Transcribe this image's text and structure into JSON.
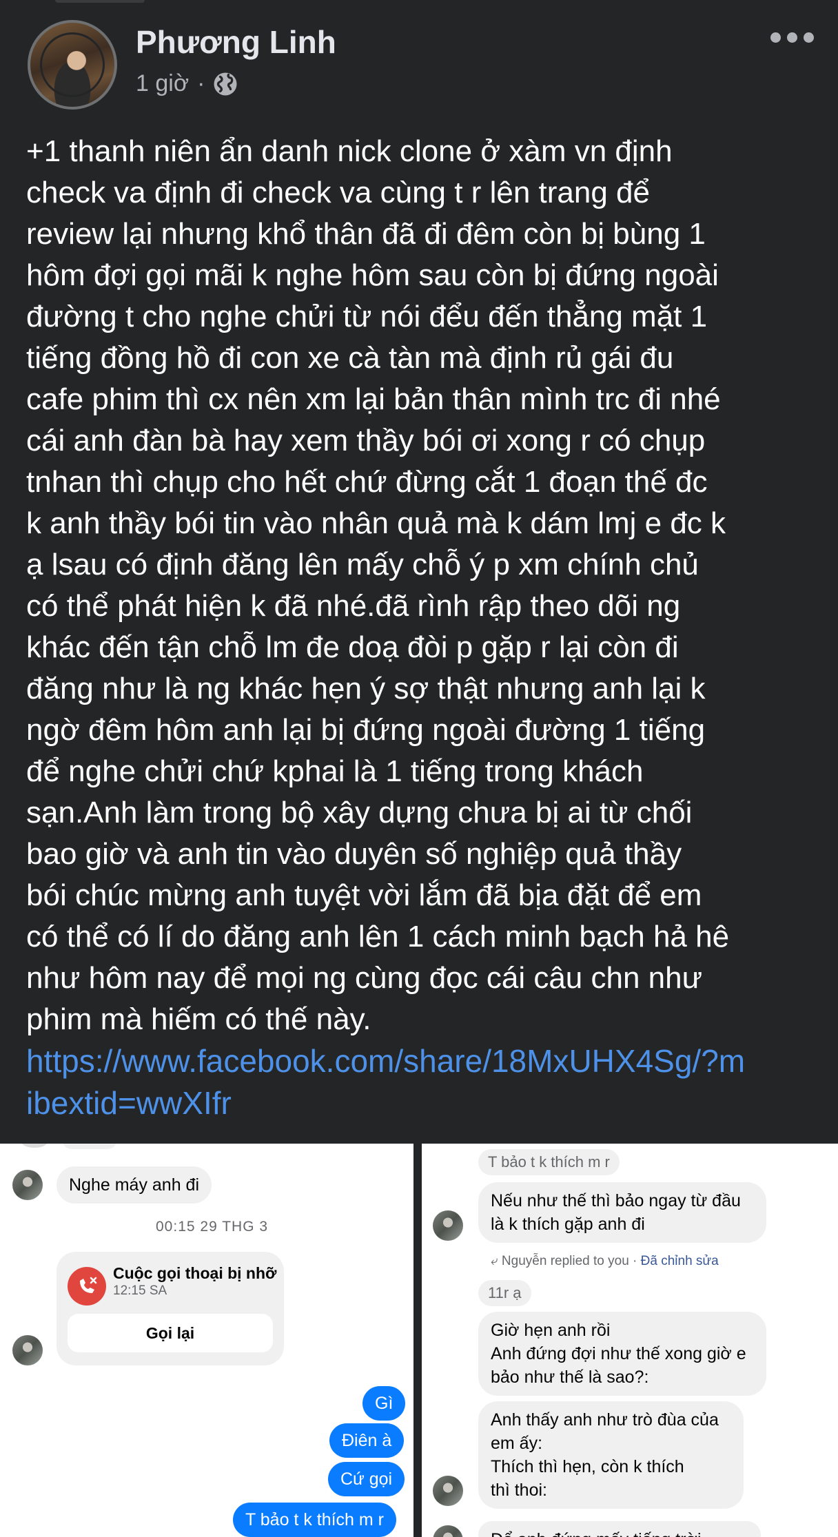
{
  "post": {
    "author": "Phương Linh",
    "time": "1 giờ",
    "separator": "·",
    "privacy_icon": "globe-icon",
    "more_icon": "more-horizontal-icon",
    "text_lines": [
      "+1 thanh niên ẩn danh nick clone ở xàm vn định",
      "check va định đi check va cùng t r lên trang để",
      "review lại nhưng khổ thân đã đi đêm còn bị bùng 1",
      "hôm đợi gọi mãi k nghe hôm sau còn bị đứng ngoài",
      "đường t cho nghe chửi từ nói đểu đến thẳng mặt 1",
      "tiếng đồng hồ đi con xe cà tàn mà định rủ gái đu",
      "cafe phim thì cx nên xm lại bản thân mình trc đi nhé",
      "cái anh đàn bà hay xem thầy bói ơi xong r có chụp",
      "tnhan thì chụp cho hết chứ đừng cắt 1 đoạn thế đc",
      "k anh thầy bói tin vào nhân quả mà k dám lmj e đc k",
      "ạ lsau có định đăng lên mấy chỗ ý p xm chính chủ",
      "có thể phát hiện k đã nhé.đã rình rập theo dõi ng",
      "khác đến tận chỗ lm đe doạ đòi p gặp r lại còn đi",
      "đăng như là ng khác hẹn ý sợ thật nhưng anh lại k",
      "ngờ đêm hôm anh lại bị đứng ngoài đường 1 tiếng",
      "để nghe chửi chứ kphai là 1 tiếng trong khách",
      "sạn.Anh làm trong bộ xây dựng chưa bị ai từ chối",
      "bao giờ và anh tin vào duyên số nghiệp quả thầy",
      "bói chúc mừng anh tuyệt vời lắm đã bịa đặt để em",
      "có thể có lí do đăng anh lên 1 cách minh bạch hả hê",
      "như hôm nay để mọi ng cùng đọc cái câu chn như",
      "phim mà hiếm có thế này."
    ],
    "link_lines": [
      "https://www.facebook.com/share/18MxUHX4Sg/?m",
      "ibextid=wwXIfr"
    ]
  },
  "left_chat": {
    "incoming_message": "Nghe máy anh đi",
    "timestamp": "00:15 29 THG 3",
    "missed_call": {
      "title": "Cuộc gọi thoại bị nhỡ",
      "time": "12:15 SA",
      "button": "Gọi lại"
    },
    "outgoing": [
      "Gì",
      "Điên à",
      "Cứ gọi",
      "T bảo t k thích m r"
    ]
  },
  "right_chat": {
    "quoted_top": "T bảo t k thích m r",
    "message1": [
      "Nếu như thế thì bảo ngay từ đầu",
      "là k thích gặp anh đi"
    ],
    "reply_header": "Nguyễn replied to you",
    "reply_edited": "Đã chỉnh sửa",
    "reply_quote": "11r ạ",
    "message2": [
      "Giờ hẹn anh rồi",
      "Anh đứng đợi như thế xong giờ e",
      "bảo như thế là sao?:"
    ],
    "message3": [
      "Anh thấy anh như trò đùa của",
      "em ấy:",
      "Thích thì hẹn, còn k thích",
      "thì thoi:"
    ],
    "message4_partial": "Để anh đứng mấy tiếng trời"
  },
  "colors": {
    "background": "#242526",
    "link": "#4e91e8",
    "messenger_blue": "#0a7cff",
    "missed_call_red": "#e0463e"
  }
}
